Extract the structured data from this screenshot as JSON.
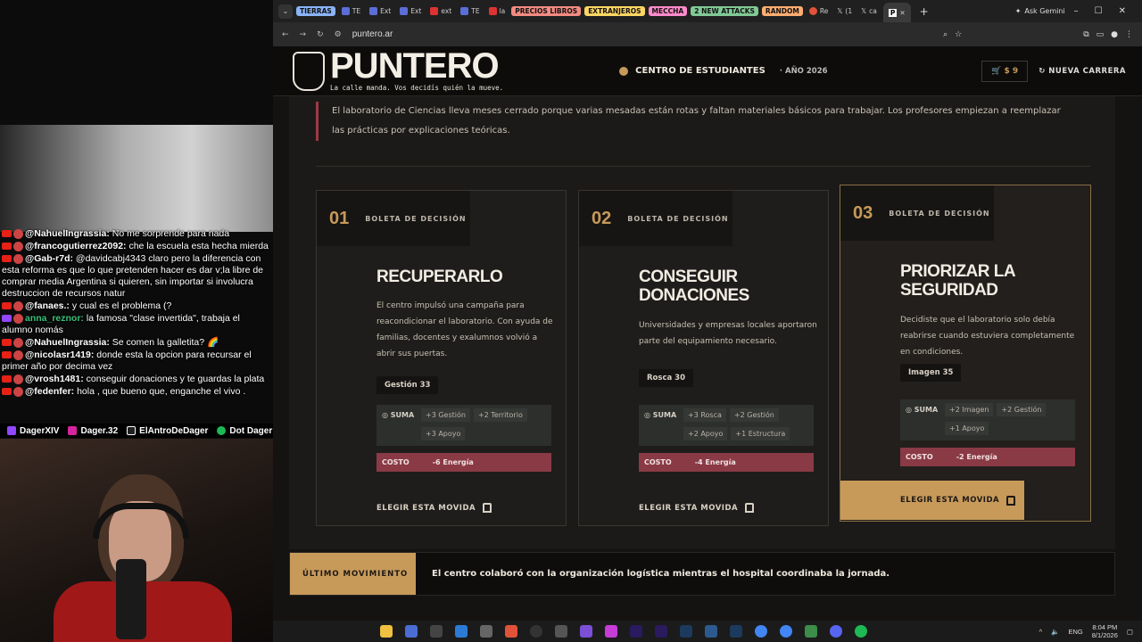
{
  "chat": [
    {
      "user": "@NahuelIngrassia:",
      "text": " No me sorprende para nada"
    },
    {
      "user": "@francogutierrez2092:",
      "text": " che la escuela esta hecha mierda"
    },
    {
      "user": "@Gab-r7d:",
      "text": " @davidcabj4343 claro pero la diferencia con esta reforma es que lo que pretenden hacer es dar v;la libre de comprar media Argentina si quieren, sin importar si involucra destruccion de recursos natur"
    },
    {
      "user": "@fanaes.:",
      "text": " y cual es el problema (?"
    },
    {
      "user": "anna_reznor:",
      "text": " la famosa \"clase invertida\", trabaja el alumno nomás"
    },
    {
      "user": "@NahuelIngrassia:",
      "text": " Se comen la galletita? 🌈"
    },
    {
      "user": "@nicolasr1419:",
      "text": " donde esta la opcion para recursar el primer año por decima vez"
    },
    {
      "user": "@vrosh1481:",
      "text": " conseguir donaciones y te guardas la plata"
    },
    {
      "user": "@fedenfer:",
      "text": " hola , que bueno que, enganche el vivo ."
    }
  ],
  "socials": [
    "DagerXIV",
    "Dager.32",
    "ElAntroDeDager",
    "Dot Dager"
  ],
  "browser": {
    "tab_groups": [
      "TIERRAS",
      "PRECIOS LIBROS",
      "EXTRANJEROS",
      "MECCHA",
      "2 NEW ATTACKS",
      "RANDOM"
    ],
    "tabs": [
      "TE",
      "Ext",
      "Ext",
      "ext",
      "TE",
      "la",
      "Re",
      "(1",
      "ca"
    ],
    "active_tab": "P",
    "new_tab": "+",
    "url": "puntero.ar",
    "ask": "Ask Gemini"
  },
  "site": {
    "logo": "PUNTERO",
    "tagline": "La calle manda. Vos decidís quién la mueve.",
    "center": "CENTRO DE ESTUDIANTES",
    "year": "· AÑO 2026",
    "wallet": "$ 9",
    "new_run": "NUEVA CARRERA",
    "story": "El laboratorio de Ciencias lleva meses cerrado porque varias mesadas están rotas y faltan materiales básicos para trabajar. Los profesores empiezan a reemplazar las prácticas por explicaciones teóricas.",
    "ballot_label": "BOLETA DE DECISIÓN",
    "suma_label": "SUMA",
    "costo_label": "COSTO",
    "choose_label": "ELEGIR ESTA MOVIDA",
    "cards": [
      {
        "num": "01",
        "title": "RECUPERARLO",
        "desc": "El centro impulsó una campaña para reacondicionar el laboratorio. Con ayuda de familias, docentes y exalumnos volvió a abrir sus puertas.",
        "stat": "Gestión 33",
        "chips": [
          "+3 Gestión",
          "+2 Territorio",
          "+3 Apoyo"
        ],
        "cost": "-6 Energía"
      },
      {
        "num": "02",
        "title": "CONSEGUIR DONACIONES",
        "desc": "Universidades y empresas locales aportaron parte del equipamiento necesario.",
        "stat": "Rosca 30",
        "chips": [
          "+3 Rosca",
          "+2 Gestión",
          "+2 Apoyo",
          "+1 Estructura"
        ],
        "cost": "-4 Energía"
      },
      {
        "num": "03",
        "title": "PRIORIZAR LA SEGURIDAD",
        "desc": "Decidiste que el laboratorio solo debía reabrirse cuando estuviera completamente en condiciones.",
        "stat": "Imagen 35",
        "chips": [
          "+2 Imagen",
          "+2 Gestión",
          "+1 Apoyo"
        ],
        "cost": "-2 Energía"
      }
    ],
    "last_move_label": "ÚLTIMO MOVIMIENTO",
    "last_move_text": "El centro colaboró con la organización logística mientras el hospital coordinaba la jornada."
  },
  "taskbar": {
    "lang": "ENG",
    "time": "8:04 PM",
    "date": "8/1/2026"
  },
  "colors": {
    "accent": "#c79a5a",
    "cost": "#8a3a45",
    "story_bar": "#9b3a44"
  }
}
